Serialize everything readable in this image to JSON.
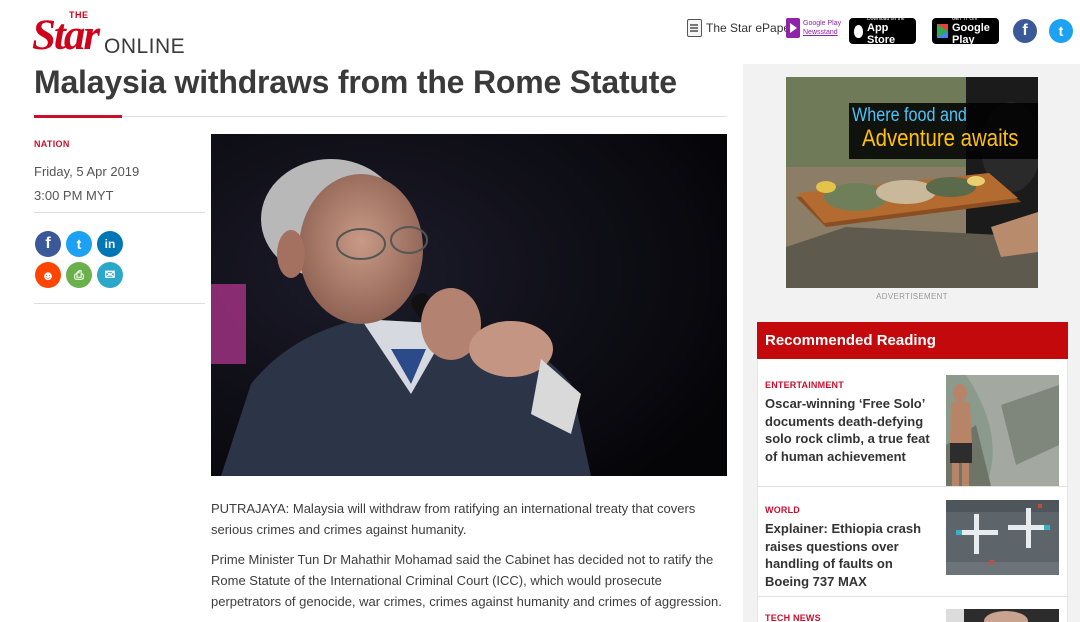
{
  "brand": {
    "the": "THE",
    "star": "Star",
    "online": "ONLINE"
  },
  "topnav": {
    "epaper": "The Star ePaper",
    "newsstand_line1": "Google Play",
    "newsstand_line2": "Newsstand",
    "appstore_small": "Download on the",
    "appstore_big": "App Store",
    "googleplay_small": "GET IT ON",
    "googleplay_big": "Google Play",
    "facebook_glyph": "f",
    "twitter_glyph": "t"
  },
  "article": {
    "headline": "Malaysia withdraws from the Rome Statute",
    "section": "NATION",
    "date": "Friday, 5 Apr 2019",
    "time": "3:00 PM MYT",
    "paragraphs": [
      "PUTRAJAYA: Malaysia will withdraw from ratifying an international treaty that covers serious crimes and crimes against humanity.",
      "Prime Minister Tun Dr Mahathir Mohamad said the Cabinet has decided not to ratify the Rome Statute of the International Criminal Court (ICC), which would prosecute perpetrators of genocide, war crimes, crimes against humanity and crimes of aggression."
    ]
  },
  "share": {
    "facebook": "f",
    "twitter": "t",
    "linkedin": "in",
    "reddit": "☻",
    "print": "⎙",
    "email": "✉"
  },
  "ad": {
    "line1": "Where food and",
    "line2": "Adventure awaits",
    "label": "ADVERTISEMENT"
  },
  "recommended": {
    "heading": "Recommended Reading",
    "items": [
      {
        "category": "ENTERTAINMENT",
        "title": "Oscar-winning ‘Free Solo’ documents death-defying solo rock climb, a true feat of human achievement"
      },
      {
        "category": "WORLD",
        "title": "Explainer: Ethiopia crash raises questions over handling of faults on Boeing 737 MAX"
      },
      {
        "category": "TECH NEWS",
        "title": ""
      }
    ]
  },
  "colors": {
    "brand_red": "#c8102e",
    "reco_red": "#c4090c",
    "facebook": "#3b5998",
    "twitter": "#1da1f2"
  }
}
